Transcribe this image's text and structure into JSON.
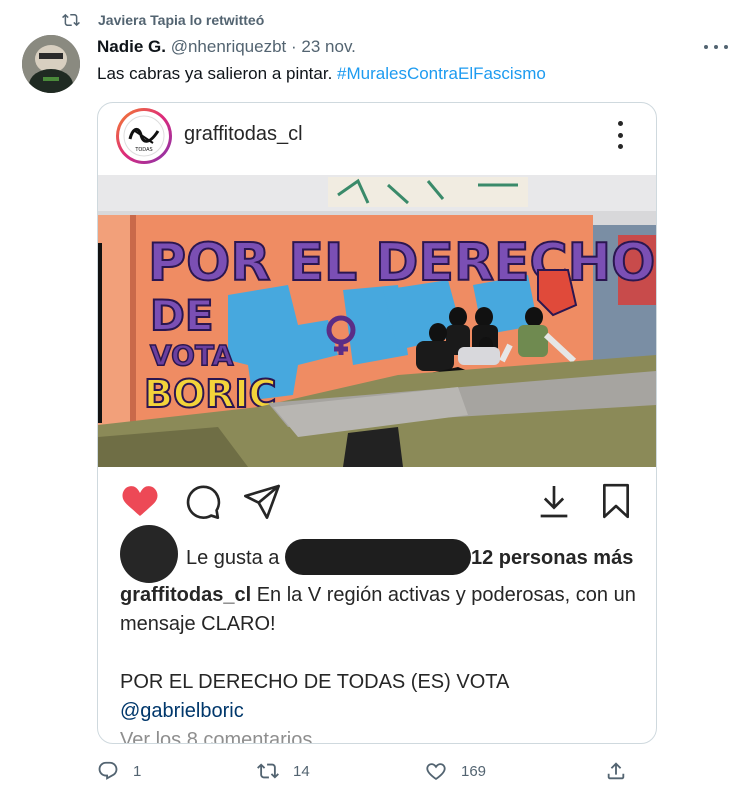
{
  "retweet": {
    "text": "Javiera Tapia lo retwitteó",
    "icon": "retweet-icon"
  },
  "tweet": {
    "author_name": "Nadie G.",
    "author_handle": "@nhenriquezbt",
    "separator": "·",
    "date": "23 nov.",
    "text_plain": "Las cabras ya salieron a pintar. ",
    "text_hashtag": "#MuralesContraElFascismo"
  },
  "embed": {
    "username": "graffitodas_cl",
    "logo_text": "TODAS",
    "mural_lines": [
      "POR EL DERECHO",
      "DE",
      "VOTA",
      "BORIC"
    ],
    "likes_prefix": "Le gusta a",
    "likes_suffix": "12 personas más",
    "caption_user": "graffitodas_cl",
    "caption_text": " En la V región activas y poderosas, con un mensaje CLARO!",
    "caption_line2": "POR EL DERECHO DE TODAS (ES) VOTA",
    "caption_mention": "@gabrielboric",
    "view_comments": "Ver los 8 comentarios"
  },
  "actions": {
    "replies": "1",
    "retweets": "14",
    "likes": "169"
  },
  "colors": {
    "accent": "#1d9bf0",
    "muted": "#536471",
    "heart": "#ed4956"
  }
}
